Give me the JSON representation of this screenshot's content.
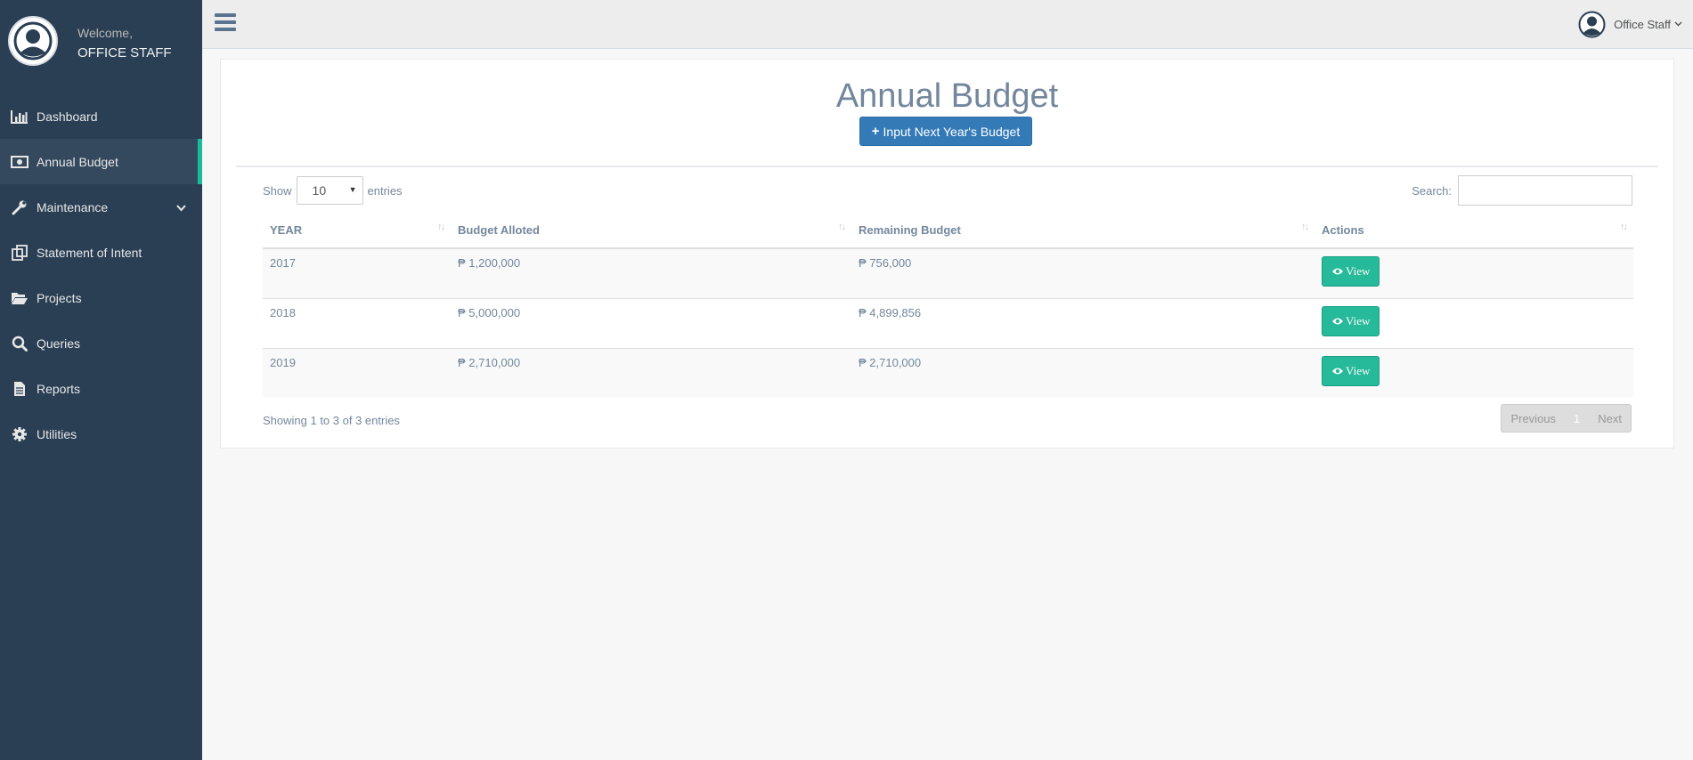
{
  "sidebar": {
    "welcome": "Welcome,",
    "username": "OFFICE STAFF",
    "items": [
      {
        "label": "Dashboard",
        "icon": "bar-chart-icon"
      },
      {
        "label": "Annual Budget",
        "icon": "money-icon",
        "active": true
      },
      {
        "label": "Maintenance",
        "icon": "wrench-icon",
        "has_submenu": true
      },
      {
        "label": "Statement of Intent",
        "icon": "clone-icon"
      },
      {
        "label": "Projects",
        "icon": "folder-open-icon"
      },
      {
        "label": "Queries",
        "icon": "search-icon"
      },
      {
        "label": "Reports",
        "icon": "file-text-icon"
      },
      {
        "label": "Utilities",
        "icon": "gear-icon"
      }
    ]
  },
  "topnav": {
    "user_label": "Office Staff"
  },
  "panel": {
    "title": "Annual Budget",
    "add_button_label": "Input Next Year's Budget"
  },
  "table_controls": {
    "show_label": "Show",
    "entries_value": "10",
    "entries_label": "entries",
    "search_label": "Search:"
  },
  "table": {
    "headers": [
      "YEAR",
      "Budget Alloted",
      "Remaining Budget",
      "Actions"
    ],
    "rows": [
      {
        "year": "2017",
        "alloted": "₱ 1,200,000",
        "remaining": "₱ 756,000",
        "action": "View"
      },
      {
        "year": "2018",
        "alloted": "₱ 5,000,000",
        "remaining": "₱ 4,899,856",
        "action": "View"
      },
      {
        "year": "2019",
        "alloted": "₱ 2,710,000",
        "remaining": "₱ 2,710,000",
        "action": "View"
      }
    ]
  },
  "footer": {
    "info": "Showing 1 to 3 of 3 entries",
    "previous": "Previous",
    "page": "1",
    "next": "Next"
  },
  "colors": {
    "sidebar_bg": "#2a3f54",
    "accent": "#1abb9c",
    "primary_button": "#337ab7",
    "view_button": "#26b99a"
  }
}
